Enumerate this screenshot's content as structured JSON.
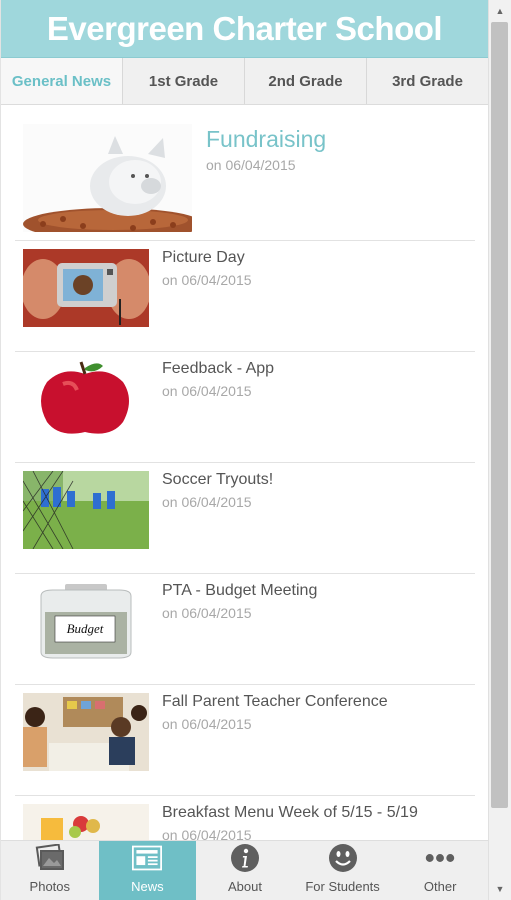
{
  "header": {
    "title": "Evergreen Charter School"
  },
  "tabs": [
    {
      "label": "General News",
      "active": true
    },
    {
      "label": "1st Grade",
      "active": false
    },
    {
      "label": "2nd Grade",
      "active": false
    },
    {
      "label": "3rd Grade",
      "active": false
    }
  ],
  "featured": {
    "title": "Fundraising",
    "date": "on 06/04/2015",
    "icon": "piggy-bank"
  },
  "items": [
    {
      "title": "Picture Day",
      "date": "on 06/04/2015",
      "icon": "camera"
    },
    {
      "title": "Feedback - App",
      "date": "on 06/04/2015",
      "icon": "apple"
    },
    {
      "title": "Soccer Tryouts!",
      "date": "on 06/04/2015",
      "icon": "soccer"
    },
    {
      "title": "PTA - Budget Meeting",
      "date": "on 06/04/2015",
      "icon": "budget-jar"
    },
    {
      "title": "Fall Parent Teacher Conference",
      "date": "on 06/04/2015",
      "icon": "classroom"
    },
    {
      "title": "Breakfast Menu Week of 5/15 - 5/19",
      "date": "on 06/04/2015",
      "icon": "breakfast"
    }
  ],
  "thumb_text": {
    "budget": "Budget"
  },
  "bottom_nav": [
    {
      "label": "Photos",
      "icon": "photos-icon",
      "active": false
    },
    {
      "label": "News",
      "icon": "news-icon",
      "active": true
    },
    {
      "label": "About",
      "icon": "info-icon",
      "active": false
    },
    {
      "label": "For Students",
      "icon": "smiley-icon",
      "active": false
    },
    {
      "label": "Other",
      "icon": "more-icon",
      "active": false
    }
  ],
  "colors": {
    "header": "#9fd7dc",
    "accent": "#6fbfc6",
    "active_tab_text": "#6bc0c7"
  }
}
